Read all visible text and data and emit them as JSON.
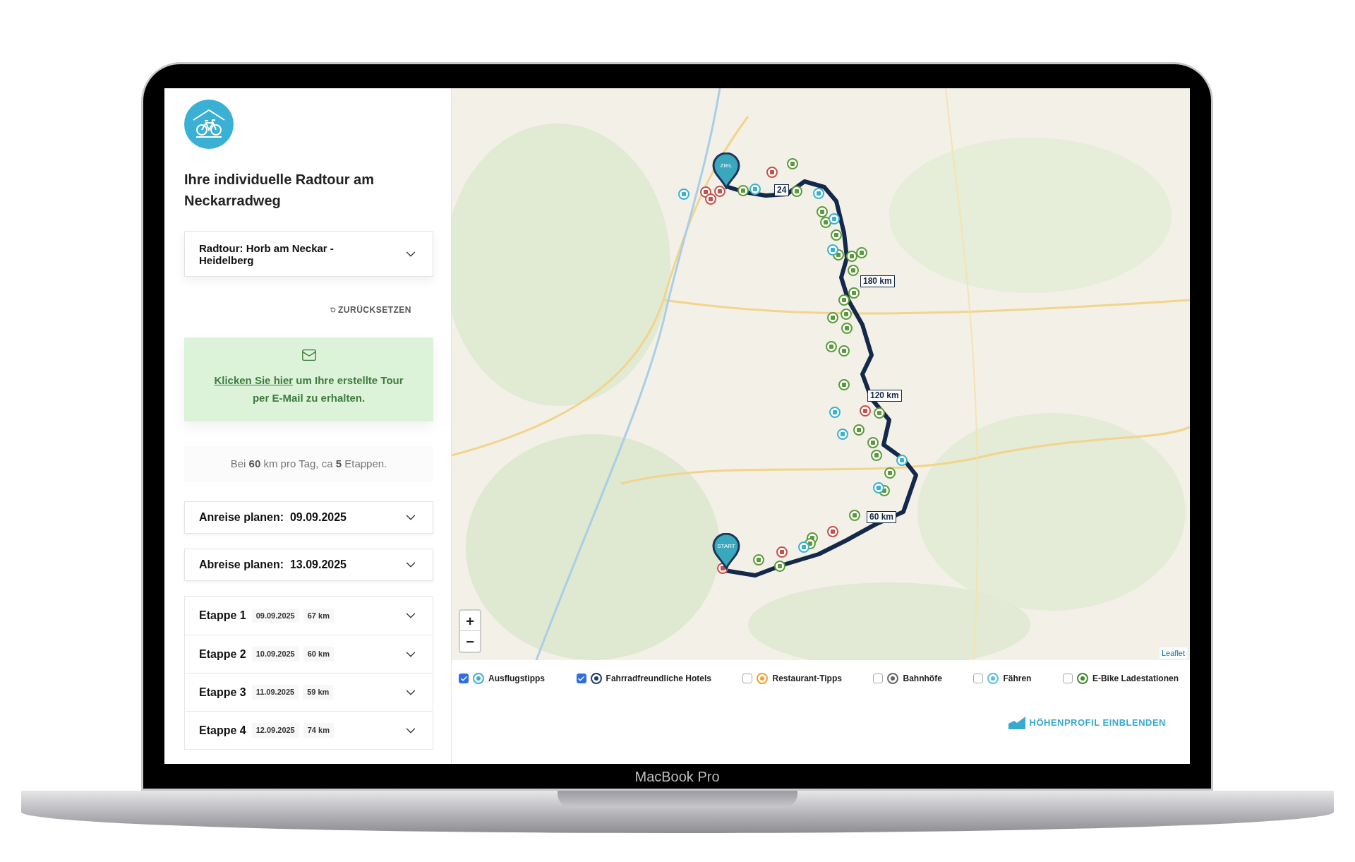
{
  "sidebar": {
    "title": "Ihre individuelle Radtour am Neckarradweg",
    "tour_select": {
      "value": "Radtour: Horb am Neckar - Heidelberg"
    },
    "reset_button": "ZURÜCKSETZEN",
    "email_box": {
      "link": "Klicken Sie hier",
      "text": "um Ihre erstellte Tour per E-Mail zu erhalten."
    },
    "summary": "Bei **60** km pro Tag, ca **5** Etappen.",
    "arrival": {
      "label": "Anreise planen:",
      "date": "09.09.2025"
    },
    "departure": {
      "label": "Abreise planen:",
      "date": "13.09.2025"
    },
    "stages": [
      {
        "label": "Etappe 1",
        "date": "09.09.2025",
        "distance": "67 km"
      },
      {
        "label": "Etappe 2",
        "date": "10.09.2025",
        "distance": "60 km"
      },
      {
        "label": "Etappe 3",
        "date": "11.09.2025",
        "distance": "59 km"
      },
      {
        "label": "Etappe 4",
        "date": "12.09.2025",
        "distance": "74 km"
      }
    ]
  },
  "map": {
    "pins": [
      {
        "label": "ZIEL"
      },
      {
        "label": "START"
      }
    ],
    "distance_labels": [
      "24",
      "180 km",
      "120 km",
      "60 km"
    ],
    "zoom_in": "+",
    "zoom_out": "−",
    "attribution": "Leaflet"
  },
  "legend": [
    {
      "label": "Ausflugstipps",
      "checked": true,
      "color": "#3bb0d0"
    },
    {
      "label": "Fahrradfreundliche Hotels",
      "checked": true,
      "color": "#1d3a6e"
    },
    {
      "label": "Restaurant-Tipps",
      "checked": false,
      "color": "#f0a030"
    },
    {
      "label": "Bahnhöfe",
      "checked": false,
      "color": "#666666"
    },
    {
      "label": "Fähren",
      "checked": false,
      "color": "#5bc0e0"
    },
    {
      "label": "E-Bike Ladestationen",
      "checked": false,
      "color": "#3f8a2a"
    }
  ],
  "elevation_button": "HÖHENPROFIL EINBLENDEN",
  "device": {
    "label": "MacBook Pro"
  }
}
